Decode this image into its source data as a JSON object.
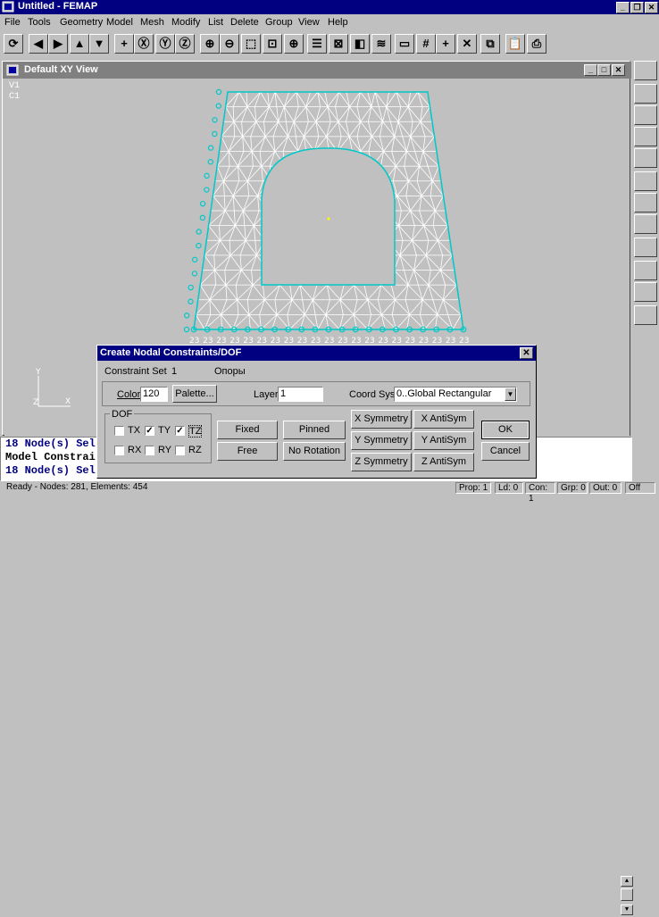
{
  "app": {
    "title": "Untitled - FEMAP"
  },
  "menu": [
    "File",
    "Tools",
    "Geometry",
    "Model",
    "Mesh",
    "Modify",
    "List",
    "Delete",
    "Group",
    "View",
    "Help"
  ],
  "view": {
    "title": "Default XY View",
    "label_v": "V1",
    "label_c": "C1",
    "node_label": "23"
  },
  "dialog": {
    "title": "Create Nodal Constraints/DOF",
    "constraint_set_label": "Constraint Set",
    "constraint_set_id": "1",
    "constraint_set_name": "Опоры",
    "color_label": "Color",
    "color_value": "120",
    "palette_button": "Palette...",
    "layer_label": "Layer",
    "layer_value": "1",
    "coord_label": "Coord Sys",
    "coord_value": "0..Global Rectangular",
    "dof_label": "DOF",
    "tx": "TX",
    "ty": "TY",
    "tz": "TZ",
    "rx": "RX",
    "ry": "RY",
    "rz": "RZ",
    "fixed": "Fixed",
    "pinned": "Pinned",
    "free": "Free",
    "no_rotation": "No Rotation",
    "x_sym": "X Symmetry",
    "x_anti": "X AntiSym",
    "y_sym": "Y Symmetry",
    "y_anti": "Y AntiSym",
    "z_sym": "Z Symmetry",
    "z_anti": "Z AntiSym",
    "ok": "OK",
    "cancel": "Cancel"
  },
  "console": {
    "line1": "18 Node(s) Sel",
    "line2": "Model Constrai",
    "line3": "18 Node(s) Sel"
  },
  "status": {
    "main": "Ready - Nodes: 281,  Elements: 454",
    "prop": "Prop: 1",
    "ld": "Ld: 0",
    "con": "Con: 1",
    "grp": "Grp: 0",
    "out": "Out: 0",
    "off": "Off"
  },
  "colors": {
    "title_active": "#000080",
    "title_inactive": "#808080",
    "mesh": "#ffffff",
    "edge": "#00c8c8",
    "node": "#ffff00"
  }
}
